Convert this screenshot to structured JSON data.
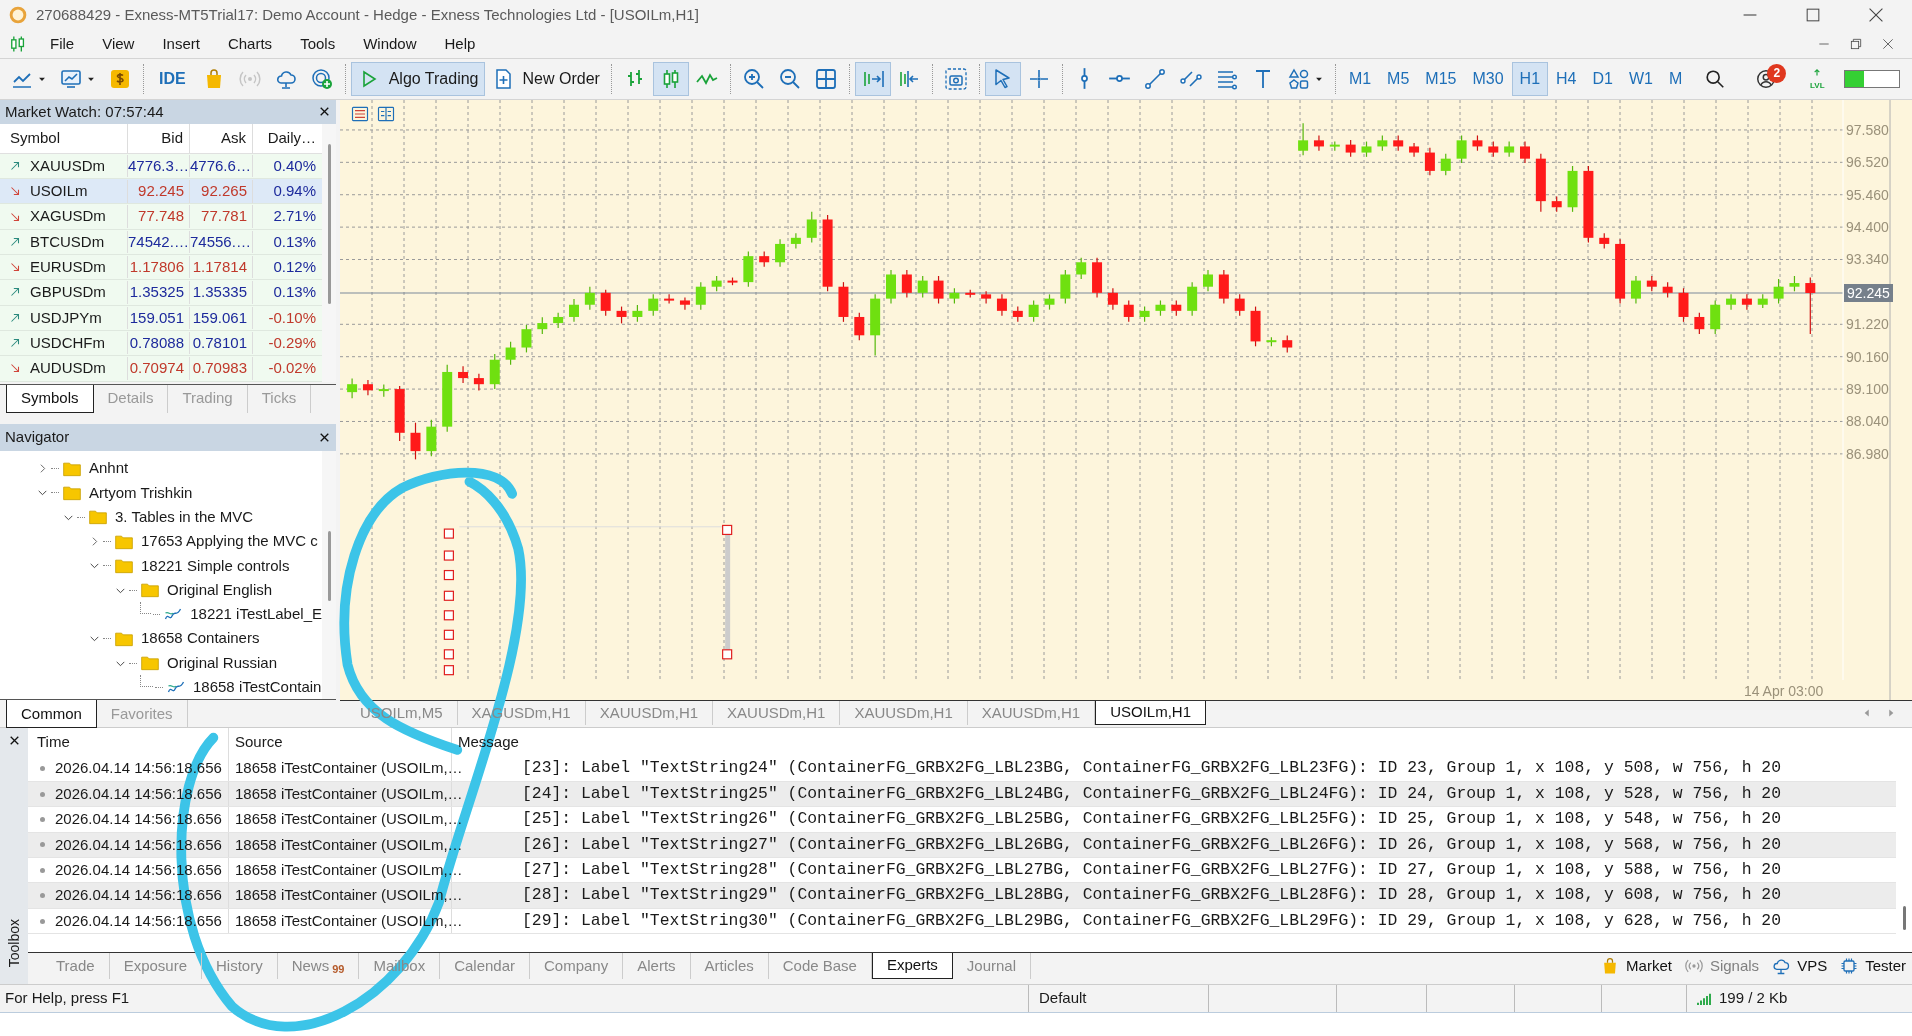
{
  "window": {
    "title": "270688429 - Exness-MT5Trial17: Demo Account - Hedge - Exness Technologies Ltd - [USOILm,H1]"
  },
  "menu": [
    "File",
    "View",
    "Insert",
    "Charts",
    "Tools",
    "Window",
    "Help"
  ],
  "toolbar": {
    "groups": [
      [
        {
          "kind": "line-chart",
          "dropdown": true,
          "pressed": false,
          "disabled": false
        },
        {
          "kind": "chart-template",
          "dropdown": true,
          "pressed": false,
          "disabled": false
        },
        {
          "kind": "dollar",
          "pressed": false,
          "disabled": false
        }
      ],
      [
        {
          "kind": "text-icon",
          "label": "IDE",
          "pressed": false,
          "disabled": false
        },
        {
          "kind": "bag",
          "pressed": false,
          "disabled": false
        },
        {
          "kind": "broadcast",
          "pressed": false,
          "disabled": true
        },
        {
          "kind": "cloud",
          "pressed": false,
          "disabled": false
        },
        {
          "kind": "target-plus",
          "pressed": false,
          "disabled": false
        }
      ],
      [
        {
          "kind": "play",
          "label": "Algo Trading",
          "pressed": true,
          "disabled": false
        },
        {
          "kind": "order",
          "label": "New Order",
          "pressed": false,
          "disabled": false
        }
      ],
      [
        {
          "kind": "bars",
          "pressed": false,
          "disabled": false
        },
        {
          "kind": "candles",
          "pressed": true,
          "disabled": false
        },
        {
          "kind": "line",
          "pressed": false,
          "disabled": false
        }
      ],
      [
        {
          "kind": "zoom-in",
          "pressed": false,
          "disabled": false
        },
        {
          "kind": "zoom-out",
          "pressed": false,
          "disabled": false
        },
        {
          "kind": "tile",
          "pressed": false,
          "disabled": false
        }
      ],
      [
        {
          "kind": "autoscroll",
          "pressed": true,
          "disabled": false
        },
        {
          "kind": "shift",
          "pressed": false,
          "disabled": false
        }
      ],
      [
        {
          "kind": "screenshot",
          "pressed": false,
          "disabled": false
        }
      ],
      [
        {
          "kind": "cursor",
          "pressed": true,
          "disabled": false
        },
        {
          "kind": "crosshair",
          "pressed": false,
          "disabled": false
        }
      ],
      [
        {
          "kind": "vline",
          "pressed": false,
          "disabled": false
        },
        {
          "kind": "hline",
          "pressed": false,
          "disabled": false
        },
        {
          "kind": "trendline",
          "pressed": false,
          "disabled": false
        },
        {
          "kind": "channel",
          "pressed": false,
          "disabled": false
        },
        {
          "kind": "fibo",
          "pressed": false,
          "disabled": false
        },
        {
          "kind": "text-tool",
          "pressed": false,
          "disabled": false
        },
        {
          "kind": "shapes",
          "dropdown": true,
          "pressed": false,
          "disabled": false
        }
      ]
    ],
    "timeframes": [
      {
        "label": "M1",
        "selected": false
      },
      {
        "label": "M5",
        "selected": false
      },
      {
        "label": "M15",
        "selected": false
      },
      {
        "label": "M30",
        "selected": false
      },
      {
        "label": "H1",
        "selected": true
      },
      {
        "label": "H4",
        "selected": false
      },
      {
        "label": "D1",
        "selected": false
      },
      {
        "label": "W1",
        "selected": false
      },
      {
        "label": "M",
        "selected": false
      }
    ],
    "notifications": "2",
    "lvl_label": "LVL",
    "meter": {
      "level": 0.35
    }
  },
  "market_watch": {
    "title": "Market Watch: 07:57:44",
    "columns": [
      "Symbol",
      "Bid",
      "Ask",
      "Daily…"
    ],
    "rows": [
      {
        "symbol": "XAUUSDm",
        "bid": "4776.3…",
        "ask": "4776.6…",
        "daily": "0.40%",
        "up": true,
        "daily_negative": false,
        "selected": false
      },
      {
        "symbol": "USOILm",
        "bid": "92.245",
        "ask": "92.265",
        "daily": "0.94%",
        "up": false,
        "daily_negative": false,
        "selected": true
      },
      {
        "symbol": "XAGUSDm",
        "bid": "77.748",
        "ask": "77.781",
        "daily": "2.71%",
        "up": false,
        "daily_negative": false,
        "selected": false
      },
      {
        "symbol": "BTCUSDm",
        "bid": "74542.…",
        "ask": "74556.…",
        "daily": "0.13%",
        "up": true,
        "daily_negative": false,
        "selected": false
      },
      {
        "symbol": "EURUSDm",
        "bid": "1.17806",
        "ask": "1.17814",
        "daily": "0.12%",
        "up": false,
        "daily_negative": false,
        "selected": false
      },
      {
        "symbol": "GBPUSDm",
        "bid": "1.35325",
        "ask": "1.35335",
        "daily": "0.13%",
        "up": true,
        "daily_negative": false,
        "selected": false
      },
      {
        "symbol": "USDJPYm",
        "bid": "159.051",
        "ask": "159.061",
        "daily": "-0.10%",
        "up": true,
        "daily_negative": true,
        "selected": false
      },
      {
        "symbol": "USDCHFm",
        "bid": "0.78088",
        "ask": "0.78101",
        "daily": "-0.29%",
        "up": true,
        "daily_negative": true,
        "selected": false
      },
      {
        "symbol": "AUDUSDm",
        "bid": "0.70974",
        "ask": "0.70983",
        "daily": "-0.02%",
        "up": false,
        "daily_negative": true,
        "selected": false
      }
    ],
    "tabs": [
      {
        "label": "Symbols",
        "selected": true
      },
      {
        "label": "Details",
        "selected": false
      },
      {
        "label": "Trading",
        "selected": false
      },
      {
        "label": "Ticks",
        "selected": false
      }
    ]
  },
  "navigator": {
    "title": "Navigator",
    "items": [
      {
        "label": "Anhnt",
        "kind": "folder",
        "expanded": false
      },
      {
        "label": "Artyom Trishkin",
        "kind": "folder",
        "expanded": true,
        "children": [
          {
            "label": "3. Tables in the MVC",
            "kind": "folder",
            "expanded": true,
            "children": [
              {
                "label": "17653 Applying the MVC c",
                "kind": "folder",
                "expanded": false
              },
              {
                "label": "18221 Simple controls",
                "kind": "folder",
                "expanded": true,
                "children": [
                  {
                    "label": "Original English",
                    "kind": "folder",
                    "expanded": true,
                    "children": [
                      {
                        "label": "18221 iTestLabel_E",
                        "kind": "program"
                      }
                    ]
                  }
                ]
              },
              {
                "label": "18658 Containers",
                "kind": "folder",
                "expanded": true,
                "children": [
                  {
                    "label": "Original Russian",
                    "kind": "folder",
                    "expanded": true,
                    "children": [
                      {
                        "label": "18658 iTestContain",
                        "kind": "program"
                      }
                    ]
                  }
                ]
              }
            ]
          }
        ]
      }
    ],
    "tabs": [
      {
        "label": "Common",
        "selected": true
      },
      {
        "label": "Favorites",
        "selected": false
      }
    ]
  },
  "chart": {
    "chart_data": {
      "type": "candlestick",
      "categories": [
        null,
        null,
        null,
        null,
        null,
        null,
        null,
        null,
        null,
        null,
        null,
        null,
        null,
        null,
        null,
        null,
        null,
        null,
        null,
        null,
        null,
        null,
        null,
        null,
        null,
        null,
        null,
        null,
        null,
        null,
        null,
        null,
        null,
        null,
        null,
        null,
        null,
        null,
        null,
        null,
        null,
        null,
        null,
        null,
        null,
        null,
        null,
        null,
        null,
        null,
        null,
        null,
        null,
        null,
        null,
        null,
        null,
        null,
        null,
        null,
        null,
        null,
        null,
        null,
        null,
        null,
        null,
        null,
        null,
        null,
        null,
        null,
        null,
        null,
        null,
        null,
        null,
        null,
        null,
        null,
        null,
        null,
        null,
        null,
        null,
        null,
        null,
        null,
        null,
        null,
        null,
        null,
        null
      ],
      "ohlc": [
        [
          89.0,
          89.45,
          88.8,
          89.26
        ],
        [
          89.26,
          89.4,
          88.9,
          89.06
        ],
        [
          89.06,
          89.25,
          88.85,
          89.1
        ],
        [
          89.1,
          89.2,
          87.4,
          87.67
        ],
        [
          87.67,
          88.0,
          86.8,
          87.07
        ],
        [
          87.07,
          88.1,
          86.9,
          87.87
        ],
        [
          87.87,
          89.9,
          87.7,
          89.66
        ],
        [
          89.66,
          89.85,
          89.3,
          89.46
        ],
        [
          89.46,
          89.6,
          89.05,
          89.26
        ],
        [
          89.26,
          90.25,
          89.1,
          90.06
        ],
        [
          90.06,
          90.65,
          89.9,
          90.46
        ],
        [
          90.46,
          91.2,
          90.3,
          91.06
        ],
        [
          91.06,
          91.45,
          90.9,
          91.26
        ],
        [
          91.26,
          91.6,
          91.1,
          91.46
        ],
        [
          91.46,
          92.05,
          91.3,
          91.86
        ],
        [
          91.86,
          92.45,
          91.7,
          92.25
        ],
        [
          92.25,
          92.35,
          91.5,
          91.66
        ],
        [
          91.66,
          91.8,
          91.25,
          91.46
        ],
        [
          91.46,
          91.85,
          91.3,
          91.66
        ],
        [
          91.66,
          92.2,
          91.5,
          92.06
        ],
        [
          92.06,
          92.2,
          91.9,
          92.0
        ],
        [
          92.0,
          92.1,
          91.7,
          91.86
        ],
        [
          91.86,
          92.6,
          91.7,
          92.45
        ],
        [
          92.45,
          92.8,
          92.3,
          92.65
        ],
        [
          92.65,
          92.75,
          92.5,
          92.6
        ],
        [
          92.6,
          93.6,
          92.45,
          93.45
        ],
        [
          93.45,
          93.6,
          93.1,
          93.25
        ],
        [
          93.25,
          94.0,
          93.1,
          93.85
        ],
        [
          93.85,
          94.2,
          93.7,
          94.05
        ],
        [
          94.05,
          94.9,
          93.9,
          94.65
        ],
        [
          94.65,
          94.8,
          92.3,
          92.45
        ],
        [
          92.45,
          92.6,
          91.3,
          91.46
        ],
        [
          91.46,
          91.6,
          90.7,
          90.86
        ],
        [
          90.86,
          92.2,
          90.2,
          92.06
        ],
        [
          92.06,
          93.0,
          91.9,
          92.85
        ],
        [
          92.85,
          93.0,
          92.1,
          92.25
        ],
        [
          92.25,
          92.8,
          92.1,
          92.65
        ],
        [
          92.65,
          92.8,
          91.9,
          92.06
        ],
        [
          92.06,
          92.4,
          91.9,
          92.25
        ],
        [
          92.25,
          92.35,
          92.1,
          92.2
        ],
        [
          92.2,
          92.3,
          91.9,
          92.06
        ],
        [
          92.06,
          92.2,
          91.5,
          91.66
        ],
        [
          91.66,
          91.8,
          91.3,
          91.46
        ],
        [
          91.46,
          92.0,
          91.3,
          91.86
        ],
        [
          91.86,
          92.2,
          91.7,
          92.06
        ],
        [
          92.06,
          93.0,
          91.9,
          92.85
        ],
        [
          92.85,
          93.4,
          92.7,
          93.25
        ],
        [
          93.25,
          93.4,
          92.1,
          92.25
        ],
        [
          92.25,
          92.4,
          91.7,
          91.86
        ],
        [
          91.86,
          92.0,
          91.3,
          91.46
        ],
        [
          91.46,
          91.8,
          91.3,
          91.66
        ],
        [
          91.66,
          92.0,
          91.5,
          91.86
        ],
        [
          91.86,
          92.0,
          91.5,
          91.66
        ],
        [
          91.66,
          92.6,
          91.5,
          92.45
        ],
        [
          92.45,
          93.0,
          92.3,
          92.85
        ],
        [
          92.85,
          93.0,
          91.9,
          92.06
        ],
        [
          92.06,
          92.2,
          91.5,
          91.66
        ],
        [
          91.66,
          91.8,
          90.5,
          90.66
        ],
        [
          90.66,
          90.8,
          90.5,
          90.7
        ],
        [
          90.7,
          90.85,
          90.3,
          90.46
        ],
        [
          96.9,
          97.8,
          96.75,
          97.24
        ],
        [
          97.24,
          97.4,
          96.9,
          97.04
        ],
        [
          97.04,
          97.2,
          96.9,
          97.1
        ],
        [
          97.1,
          97.25,
          96.7,
          96.84
        ],
        [
          96.84,
          97.2,
          96.7,
          97.04
        ],
        [
          97.04,
          97.4,
          96.9,
          97.24
        ],
        [
          97.24,
          97.4,
          96.9,
          97.04
        ],
        [
          97.04,
          97.15,
          96.7,
          96.84
        ],
        [
          96.84,
          97.0,
          96.1,
          96.24
        ],
        [
          96.24,
          96.8,
          96.1,
          96.64
        ],
        [
          96.64,
          97.4,
          96.5,
          97.24
        ],
        [
          97.24,
          97.4,
          96.9,
          97.04
        ],
        [
          97.04,
          97.2,
          96.7,
          96.84
        ],
        [
          96.84,
          97.2,
          96.7,
          97.04
        ],
        [
          97.04,
          97.2,
          96.5,
          96.64
        ],
        [
          96.64,
          96.8,
          94.9,
          95.25
        ],
        [
          95.25,
          95.4,
          94.9,
          95.05
        ],
        [
          95.05,
          96.4,
          94.9,
          96.24
        ],
        [
          96.24,
          96.4,
          93.9,
          94.05
        ],
        [
          94.05,
          94.2,
          93.7,
          93.85
        ],
        [
          93.85,
          94.0,
          91.9,
          92.06
        ],
        [
          92.06,
          92.8,
          91.9,
          92.65
        ],
        [
          92.65,
          92.8,
          92.3,
          92.45
        ],
        [
          92.45,
          92.6,
          92.1,
          92.25
        ],
        [
          92.25,
          92.4,
          91.3,
          91.46
        ],
        [
          91.46,
          91.6,
          90.9,
          91.06
        ],
        [
          91.06,
          92.0,
          90.9,
          91.86
        ],
        [
          91.86,
          92.2,
          91.7,
          92.06
        ],
        [
          92.06,
          92.2,
          91.7,
          91.86
        ],
        [
          91.86,
          92.2,
          91.75,
          92.06
        ],
        [
          92.06,
          92.7,
          91.9,
          92.45
        ],
        [
          92.45,
          92.8,
          92.3,
          92.57
        ],
        [
          92.57,
          92.75,
          90.9,
          92.245
        ]
      ],
      "ylim": [
        79.58,
        98.56
      ],
      "grid": true,
      "ref_lines": [
        {
          "axis": "y",
          "value": 92.245
        }
      ],
      "yticks": [
        {
          "value": 97.58,
          "label": "97.580"
        },
        {
          "value": 96.52,
          "label": "96.520"
        },
        {
          "value": 95.46,
          "label": "95.460"
        },
        {
          "value": 94.4,
          "label": "94.400"
        },
        {
          "value": 93.34,
          "label": "93.340"
        },
        {
          "value": 91.22,
          "label": "91.220"
        },
        {
          "value": 90.16,
          "label": "90.160"
        },
        {
          "value": 89.1,
          "label": "89.100"
        },
        {
          "value": 88.04,
          "label": "88.040"
        },
        {
          "value": 86.98,
          "label": "86.980"
        }
      ],
      "orientation": "vertical"
    },
    "current_price": "92.245",
    "time_label": "14 Apr 03:00",
    "tabs": [
      {
        "label": "USOILm,M5",
        "selected": false
      },
      {
        "label": "XAGUSDm,H1",
        "selected": false
      },
      {
        "label": "XAUUSDm,H1",
        "selected": false
      },
      {
        "label": "XAUUSDm,H1",
        "selected": false
      },
      {
        "label": "XAUUSDm,H1",
        "selected": false
      },
      {
        "label": "XAUUSDm,H1",
        "selected": false
      },
      {
        "label": "USOILm,H1",
        "selected": true
      }
    ]
  },
  "toolbox": {
    "side_label": "Toolbox",
    "columns": [
      "Time",
      "Source",
      "Message"
    ],
    "rows": [
      {
        "time": "2026.04.14 14:56:18.656",
        "source": "18658 iTestContainer (USOILm,…",
        "message": "[23]: Label \"TextString24\" (ContainerFG_GRBX2FG_LBL23BG, ContainerFG_GRBX2FG_LBL23FG): ID 23, Group 1, x 108, y 508, w 756, h 20"
      },
      {
        "time": "2026.04.14 14:56:18.656",
        "source": "18658 iTestContainer (USOILm,…",
        "message": "[24]: Label \"TextString25\" (ContainerFG_GRBX2FG_LBL24BG, ContainerFG_GRBX2FG_LBL24FG): ID 24, Group 1, x 108, y 528, w 756, h 20"
      },
      {
        "time": "2026.04.14 14:56:18.656",
        "source": "18658 iTestContainer (USOILm,…",
        "message": "[25]: Label \"TextString26\" (ContainerFG_GRBX2FG_LBL25BG, ContainerFG_GRBX2FG_LBL25FG): ID 25, Group 1, x 108, y 548, w 756, h 20"
      },
      {
        "time": "2026.04.14 14:56:18.656",
        "source": "18658 iTestContainer (USOILm,…",
        "message": "[26]: Label \"TextString27\" (ContainerFG_GRBX2FG_LBL26BG, ContainerFG_GRBX2FG_LBL26FG): ID 26, Group 1, x 108, y 568, w 756, h 20"
      },
      {
        "time": "2026.04.14 14:56:18.656",
        "source": "18658 iTestContainer (USOILm,…",
        "message": "[27]: Label \"TextString28\" (ContainerFG_GRBX2FG_LBL27BG, ContainerFG_GRBX2FG_LBL27FG): ID 27, Group 1, x 108, y 588, w 756, h 20"
      },
      {
        "time": "2026.04.14 14:56:18.656",
        "source": "18658 iTestContainer (USOILm,…",
        "message": "[28]: Label \"TextString29\" (ContainerFG_GRBX2FG_LBL28BG, ContainerFG_GRBX2FG_LBL28FG): ID 28, Group 1, x 108, y 608, w 756, h 20"
      },
      {
        "time": "2026.04.14 14:56:18.656",
        "source": "18658 iTestContainer (USOILm,…",
        "message": "[29]: Label \"TextString30\" (ContainerFG_GRBX2FG_LBL29BG, ContainerFG_GRBX2FG_LBL29FG): ID 29, Group 1, x 108, y 628, w 756, h 20"
      }
    ],
    "tabs": [
      {
        "label": "Trade",
        "selected": false
      },
      {
        "label": "Exposure",
        "selected": false
      },
      {
        "label": "History",
        "selected": false
      },
      {
        "label": "News",
        "badge": "99",
        "selected": false
      },
      {
        "label": "Mailbox",
        "selected": false
      },
      {
        "label": "Calendar",
        "selected": false
      },
      {
        "label": "Company",
        "selected": false
      },
      {
        "label": "Alerts",
        "selected": false
      },
      {
        "label": "Articles",
        "selected": false
      },
      {
        "label": "Code Base",
        "selected": false
      },
      {
        "label": "Experts",
        "selected": true
      },
      {
        "label": "Journal",
        "selected": false
      }
    ],
    "links": [
      {
        "label": "Market",
        "kind": "bag",
        "disabled": false
      },
      {
        "label": "Signals",
        "kind": "broadcast",
        "disabled": true
      },
      {
        "label": "VPS",
        "kind": "cloud",
        "disabled": false
      },
      {
        "label": "Tester",
        "kind": "chip",
        "disabled": false
      }
    ]
  },
  "status_bar": {
    "help": "For Help, press F1",
    "profile": "Default",
    "traffic": "199 / 2 Kb"
  }
}
